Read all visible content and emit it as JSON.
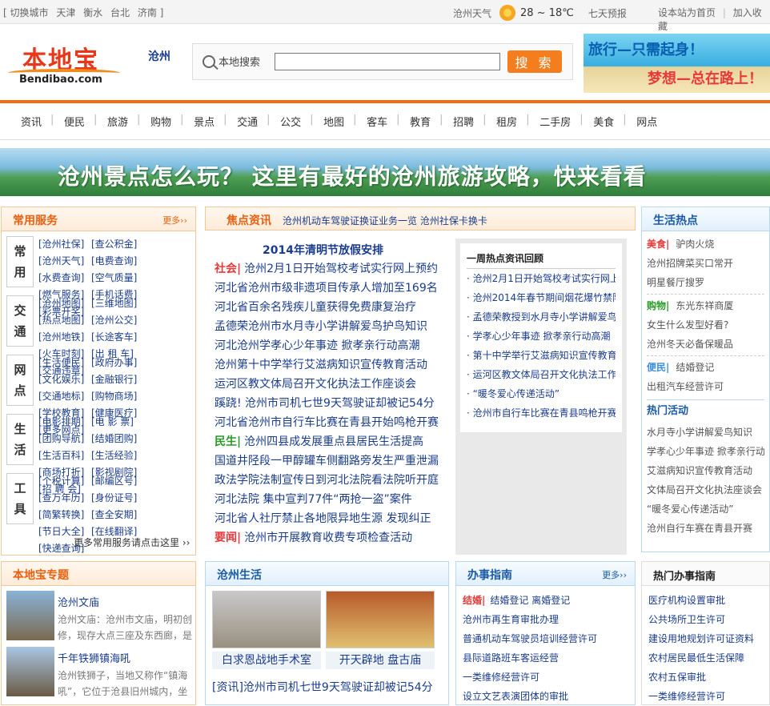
{
  "topbar": {
    "switch_city": "[ 切换城市",
    "cities": [
      "天津",
      "衡水",
      "台北",
      "济南 ]"
    ],
    "weather_city": "沧州天气",
    "weather_icon": "sun-icon",
    "temp": "28 ~ 18℃",
    "forecast": "七天预报",
    "set_home": "设本站为首页",
    "divider": "|",
    "favorite": "加入收藏"
  },
  "header": {
    "logo_cn": "本地宝",
    "logo_en": "Bendibao.com",
    "current_city": "沧州",
    "search_label": "本地搜索",
    "search_value": "",
    "search_button": "搜 索",
    "banner_line1": "旅行—只需起身！",
    "banner_line2": "梦想—总在路上！"
  },
  "nav": [
    "资讯",
    "便民",
    "旅游",
    "购物",
    "景点",
    "交通",
    "公交",
    "地图",
    "客车",
    "教育",
    "招聘",
    "租房",
    "二手房",
    "美食",
    "网点"
  ],
  "big_banner": "沧州景点怎么玩？ 这里有最好的沧州旅游攻略，快来看看",
  "services": {
    "title": "常用服务",
    "more": "更多››",
    "rows": [
      {
        "cat1": "常",
        "cat2": "用",
        "links": [
          "[沧州社保]",
          "[查公积金]",
          "[沧州天气]",
          "[电费查询]",
          "[水费查询]",
          "[空气质量]",
          "[燃气服务]",
          "[手机话费]",
          "[彩票开奖]"
        ]
      },
      {
        "cat1": "交",
        "cat2": "通",
        "links": [
          "[沧州地图]",
          "[三维地图]",
          "[热点地图]",
          "[沧州公交]",
          "[沧州地铁]",
          "[长途客车]",
          "[火车时刻]",
          "[出 租 车]",
          "[交通违章]"
        ]
      },
      {
        "cat1": "网",
        "cat2": "点",
        "links": [
          "[生活便民]",
          "[政府办事]",
          "[文化娱乐]",
          "[金融银行]",
          "[交通地标]",
          "[购物商场]",
          "[学校教育]",
          "[健康医疗]",
          "[更多网点]"
        ]
      },
      {
        "cat1": "生",
        "cat2": "活",
        "links": [
          "[电影排期]",
          "[电 影 票]",
          "[团购导航]",
          "[结婚团购]",
          "[生活百科]",
          "[生活经验]",
          "[商场打折]",
          "[影视剧院]",
          "[招 聘 会]"
        ]
      },
      {
        "cat1": "工",
        "cat2": "具",
        "links": [
          "[个税计算]",
          "[邮编区号]",
          "[查万年历]",
          "[身份证号]",
          "[简繁转换]",
          "[查全安期]",
          "[节日大全]",
          "[在线翻译]",
          "[快递查询]"
        ]
      }
    ],
    "more_link": "更多常用服务请点击这里 ››"
  },
  "news": {
    "title": "焦点资讯",
    "header_links": "沧州机动车驾驶证换证业务一览 沧州社保卡换卡",
    "headline": "2014年清明节放假安排",
    "items": [
      {
        "tag": "社会|",
        "text": "沧州2月1日开始驾校考试实行网上预约"
      },
      {
        "tag": "",
        "text": "河北省沧州市级非遗项目传承人增加至169名"
      },
      {
        "tag": "",
        "text": "河北省百余名残疾儿童获得免费康复治疗"
      },
      {
        "tag": "",
        "text": "孟德荣沧州市水月寺小学讲解爱鸟护鸟知识"
      },
      {
        "tag": "",
        "text": "河北沧州学孝心少年事迹 掀孝亲行动高潮"
      },
      {
        "tag": "",
        "text": "沧州第十中学举行艾滋病知识宣传教育活动"
      },
      {
        "tag": "",
        "text": "运河区教文体局召开文化执法工作座谈会"
      },
      {
        "tag": "",
        "text": "蹊跷! 沧州市司机七世9天驾驶证却被记54分"
      },
      {
        "tag": "",
        "text": "河北省沧州市自行车比赛在青县开始鸣枪开赛"
      },
      {
        "tag": "民生|",
        "text": "沧州四县成发展重点县居民生活提高"
      },
      {
        "tag": "",
        "text": "国道井陉段一甲醇罐车侧翻路旁发生严重泄漏"
      },
      {
        "tag": "",
        "text": "政法学院法制宣传日到河北法院看法院听开庭"
      },
      {
        "tag": "",
        "text": "河北法院 集中宣判77件“两抢一盗”案件"
      },
      {
        "tag": "",
        "text": "河北省人社厅禁止各地限异地生源 发现纠正"
      },
      {
        "tag": "要闻|",
        "text": "沧州市开展教育收费专项检查活动"
      }
    ],
    "review_title": "一周热点资讯回顾",
    "review": [
      "· 沧州2月1日开始驾校考试实行网上",
      "· 沧州2014年春节期间烟花爆竹禁限",
      "· 孟德荣教授到水月寺小学讲解爱鸟",
      "· 学孝心少年事迹 掀孝亲行动高潮",
      "· 第十中学举行艾滋病知识宣传教育",
      "· 运河区教文体局召开文化执法工作",
      "· “暖冬爱心传递活动”",
      "· 沧州市自行车比赛在青县鸣枪开赛"
    ]
  },
  "life_hot": {
    "title": "生活热点",
    "rows": [
      {
        "tag": "美食|",
        "text": "驴肉火烧"
      },
      {
        "tag": "",
        "text": "沧州招牌菜买口常开"
      },
      {
        "tag": "",
        "text": "明星餐厅搜罗"
      },
      {
        "tag": "购物|",
        "text": "东光东祥商厦"
      },
      {
        "tag": "",
        "text": "女生什么发型好看?"
      },
      {
        "tag": "",
        "text": "沧州冬天必备保暖品"
      },
      {
        "tag": "便民|",
        "text": "结婚登记"
      },
      {
        "tag": "",
        "text": "出租汽车经营许可"
      }
    ],
    "hot_title": "热门活动",
    "hot": [
      "水月寺小学讲解爱鸟知识",
      "学孝心少年事迹 掀孝亲行动",
      "艾滋病知识宣传教育活动",
      "文体局召开文化执法座谈会",
      "“暖冬爱心传递活动”",
      "沧州自行车赛在青县开赛"
    ]
  },
  "topics": {
    "title": "本地宝专题",
    "items": [
      {
        "name": "沧州文庙",
        "desc": "沧州文庙：沧州市文庙，明初创修，现存大点三座及东西廊，是"
      },
      {
        "name": "千年铁狮镇海吼",
        "desc": "沧州铁狮子，当地又称作“镇海吼”，它位于沧县旧州城内，坐"
      }
    ]
  },
  "cz_life": {
    "title": "沧州生活",
    "photos": [
      "白求恩战地手术室",
      "开天辟地 盘古庙"
    ],
    "items": [
      "[资讯]沧州市司机七世9天驾驶证却被记54分"
    ]
  },
  "guide": {
    "title": "办事指南",
    "more": "更多››",
    "rows": [
      {
        "tag": "结婚|",
        "text": "结婚登记 离婚登记"
      },
      {
        "tag": "",
        "text": "沧州市再生育审批办理"
      },
      {
        "tag": "",
        "text": "普通机动车驾驶员培训经营许可"
      },
      {
        "tag": "",
        "text": "县际道路班车客运经营"
      },
      {
        "tag": "",
        "text": "一类维修经营许可"
      },
      {
        "tag": "",
        "text": "设立文艺表演团体的审批"
      }
    ]
  },
  "hot_guide": {
    "title": "热门办事指南",
    "rows": [
      "医疗机构设置审批",
      "公共场所卫生许可",
      "建设用地规划许可证资料",
      "农村居民最低生活保障",
      "农村五保审批",
      "一类维修经营许可"
    ]
  }
}
